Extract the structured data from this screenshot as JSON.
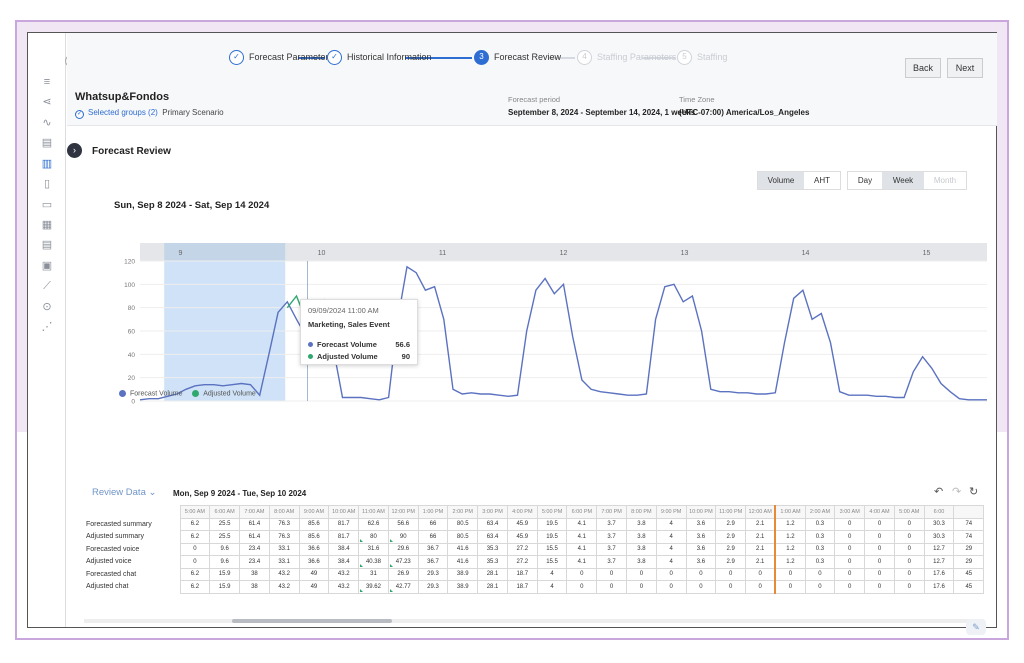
{
  "stepper": {
    "steps": [
      {
        "label": "Forecast Parameters",
        "num": "✓",
        "state": "done"
      },
      {
        "label": "Historical Information",
        "num": "✓",
        "state": "done"
      },
      {
        "label": "Forecast Review",
        "num": "3",
        "state": "current"
      },
      {
        "label": "Staffing Parameters",
        "num": "4",
        "state": "disabled"
      },
      {
        "label": "Staffing",
        "num": "5",
        "state": "disabled"
      }
    ],
    "back_label": "Back",
    "next_label": "Next"
  },
  "header": {
    "app_title": "Whatsup&Fondos",
    "selected_groups": "Selected groups (2)",
    "scenario": "Primary Scenario",
    "period_label": "Forecast period",
    "period_value": "September 8, 2024 - September 14, 2024, 1 weeks",
    "tz_label": "Time Zone",
    "tz_value": "(UTC-07:00) America/Los_Angeles"
  },
  "review": {
    "title": "Forecast Review",
    "metric_toggle": [
      "Volume",
      "AHT"
    ],
    "metric_selected": "Volume",
    "period_toggle": [
      "Day",
      "Week",
      "Month"
    ],
    "period_selected": "Week",
    "date_range": "Sun, Sep 8 2024 - Sat, Sep 14 2024"
  },
  "chart_data": {
    "type": "line",
    "x_day_labels": [
      "9",
      "10",
      "11",
      "12",
      "13",
      "14",
      "15"
    ],
    "y_ticks": [
      0,
      20,
      40,
      60,
      80,
      100,
      120
    ],
    "ylim": [
      0,
      120
    ],
    "selection_day": "10",
    "series": [
      {
        "name": "Forecast Volume",
        "color": "#5b72c0",
        "values": [
          1,
          2,
          2,
          4,
          6,
          10,
          13,
          14,
          14,
          13,
          14,
          15,
          14,
          5,
          40,
          76,
          85,
          70,
          56,
          68,
          86,
          45,
          3,
          3,
          3,
          2,
          1,
          3,
          70,
          115,
          110,
          95,
          98,
          70,
          10,
          6,
          7,
          6,
          6,
          5,
          4,
          5,
          60,
          95,
          105,
          92,
          100,
          55,
          18,
          10,
          8,
          7,
          6,
          5,
          5,
          6,
          70,
          98,
          100,
          85,
          90,
          60,
          10,
          8,
          8,
          7,
          7,
          6,
          6,
          7,
          50,
          88,
          95,
          70,
          75,
          50,
          8,
          5,
          5,
          5,
          4,
          4,
          3,
          3,
          25,
          38,
          28,
          15,
          8,
          2,
          1,
          1,
          1
        ]
      },
      {
        "name": "Adjusted Volume",
        "color": "#2ea86f",
        "points": [
          [
            16,
            80
          ],
          [
            17,
            90
          ],
          [
            18,
            70
          ]
        ]
      }
    ],
    "tooltip": {
      "time": "09/09/2024 11:00 AM",
      "event": "Marketing, Sales Event",
      "forecast_label": "Forecast Volume",
      "forecast_value": "56.6",
      "adjusted_label": "Adjusted Volume",
      "adjusted_value": "90"
    }
  },
  "table": {
    "label": "Review Data",
    "date_range": "Mon, Sep 9 2024 - Tue, Sep 10 2024",
    "headers": [
      "5:00 AM",
      "6:00 AM",
      "7:00 AM",
      "8:00 AM",
      "9:00 AM",
      "10:00 AM",
      "11:00 AM",
      "12:00 PM",
      "1:00 PM",
      "2:00 PM",
      "3:00 PM",
      "4:00 PM",
      "5:00 PM",
      "6:00 PM",
      "7:00 PM",
      "8:00 PM",
      "9:00 PM",
      "10:00 PM",
      "11:00 PM",
      "12:00 AM",
      "1:00 AM",
      "2:00 AM",
      "3:00 AM",
      "4:00 AM",
      "5:00 AM",
      "6:00"
    ],
    "rows": [
      {
        "label": "Forecasted summary",
        "values": [
          "6.2",
          "25.5",
          "61.4",
          "76.3",
          "85.6",
          "81.7",
          "62.6",
          "56.6",
          "66",
          "80.5",
          "63.4",
          "45.9",
          "19.5",
          "4.1",
          "3.7",
          "3.8",
          "4",
          "3.6",
          "2.9",
          "2.1",
          "1.2",
          "0.3",
          "0",
          "0",
          "0",
          "30.3",
          "74"
        ]
      },
      {
        "label": "Adjusted summary",
        "values": [
          "6.2",
          "25.5",
          "61.4",
          "76.3",
          "85.6",
          "81.7",
          "80",
          "90",
          "66",
          "80.5",
          "63.4",
          "45.9",
          "19.5",
          "4.1",
          "3.7",
          "3.8",
          "4",
          "3.6",
          "2.9",
          "2.1",
          "1.2",
          "0.3",
          "0",
          "0",
          "0",
          "30.3",
          "74"
        ]
      },
      {
        "label": "Forecasted voice",
        "values": [
          "0",
          "9.6",
          "23.4",
          "33.1",
          "36.6",
          "38.4",
          "31.6",
          "29.6",
          "36.7",
          "41.6",
          "35.3",
          "27.2",
          "15.5",
          "4.1",
          "3.7",
          "3.8",
          "4",
          "3.6",
          "2.9",
          "2.1",
          "1.2",
          "0.3",
          "0",
          "0",
          "0",
          "12.7",
          "29"
        ]
      },
      {
        "label": "Adjusted voice",
        "values": [
          "0",
          "9.6",
          "23.4",
          "33.1",
          "36.6",
          "38.4",
          "40.38",
          "47.23",
          "36.7",
          "41.6",
          "35.3",
          "27.2",
          "15.5",
          "4.1",
          "3.7",
          "3.8",
          "4",
          "3.6",
          "2.9",
          "2.1",
          "1.2",
          "0.3",
          "0",
          "0",
          "0",
          "12.7",
          "29"
        ]
      },
      {
        "label": "Forecasted chat",
        "values": [
          "6.2",
          "15.9",
          "38",
          "43.2",
          "49",
          "43.2",
          "31",
          "26.9",
          "29.3",
          "38.9",
          "28.1",
          "18.7",
          "4",
          "0",
          "0",
          "0",
          "0",
          "0",
          "0",
          "0",
          "0",
          "0",
          "0",
          "0",
          "0",
          "17.6",
          "45"
        ]
      },
      {
        "label": "Adjusted chat",
        "values": [
          "6.2",
          "15.9",
          "38",
          "43.2",
          "49",
          "43.2",
          "39.62",
          "42.77",
          "29.3",
          "38.9",
          "28.1",
          "18.7",
          "4",
          "0",
          "0",
          "0",
          "0",
          "0",
          "0",
          "0",
          "0",
          "0",
          "0",
          "0",
          "0",
          "17.6",
          "45"
        ]
      }
    ],
    "adjusted_row_marker_cols": [
      6,
      7
    ]
  }
}
